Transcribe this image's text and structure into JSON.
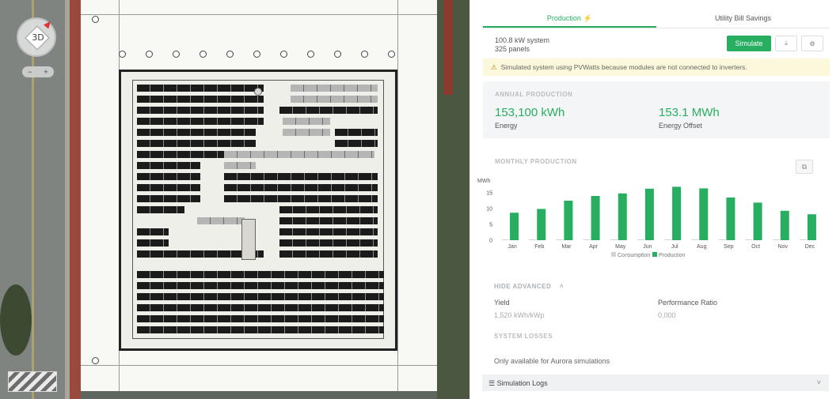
{
  "map": {
    "compass_label": "3D",
    "zoom_minus": "−",
    "zoom_plus": "+"
  },
  "tabs": [
    {
      "label": "Production",
      "active": true
    },
    {
      "label": "Utility Bill Savings",
      "active": false
    }
  ],
  "tab_bolt_icon": "lightning-icon",
  "system": {
    "size": "100.8 kW system",
    "panels": "325 panels"
  },
  "actions": {
    "simulate_label": "Simulate",
    "download_icon": "download-icon",
    "settings_icon": "gear-icon"
  },
  "warning": {
    "text": "Simulated system using PVWatts because modules are not connected to inverters."
  },
  "annual": {
    "title": "ANNUAL PRODUCTION",
    "energy_value": "153,100 kWh",
    "energy_label": "Energy",
    "offset_value": "153.1 MWh",
    "offset_label": "Energy Offset"
  },
  "monthly": {
    "title": "MONTHLY PRODUCTION",
    "copy_icon": "copy-icon"
  },
  "chart_data": {
    "type": "bar",
    "categories": [
      "Jan",
      "Feb",
      "Mar",
      "Apr",
      "May",
      "Jun",
      "Jul",
      "Aug",
      "Sep",
      "Oct",
      "Nov",
      "Dec"
    ],
    "series": [
      {
        "name": "Consumption",
        "values": [
          0,
          0,
          0,
          0,
          0,
          0,
          0,
          0,
          0,
          0,
          0,
          0
        ],
        "color": "#cfd3d6"
      },
      {
        "name": "Production",
        "values": [
          8.7,
          9.9,
          12.5,
          14.0,
          14.8,
          16.3,
          16.9,
          16.4,
          13.5,
          11.9,
          9.3,
          8.2
        ],
        "color": "#27ae60"
      }
    ],
    "ylabel": "MWh",
    "yticks": [
      0,
      5,
      10,
      15
    ],
    "ylim": [
      0,
      18
    ],
    "grid": false,
    "legend_position": "bottom"
  },
  "advanced": {
    "toggle_label": "HIDE ADVANCED",
    "yield_label": "Yield",
    "yield_value": "1,520 kWh/kWp",
    "pr_label": "Performance Ratio",
    "pr_value": "0.000"
  },
  "losses": {
    "title": "SYSTEM LOSSES",
    "note": "Only available for Aurora simulations"
  },
  "logs": {
    "label": "Simulation Logs"
  }
}
